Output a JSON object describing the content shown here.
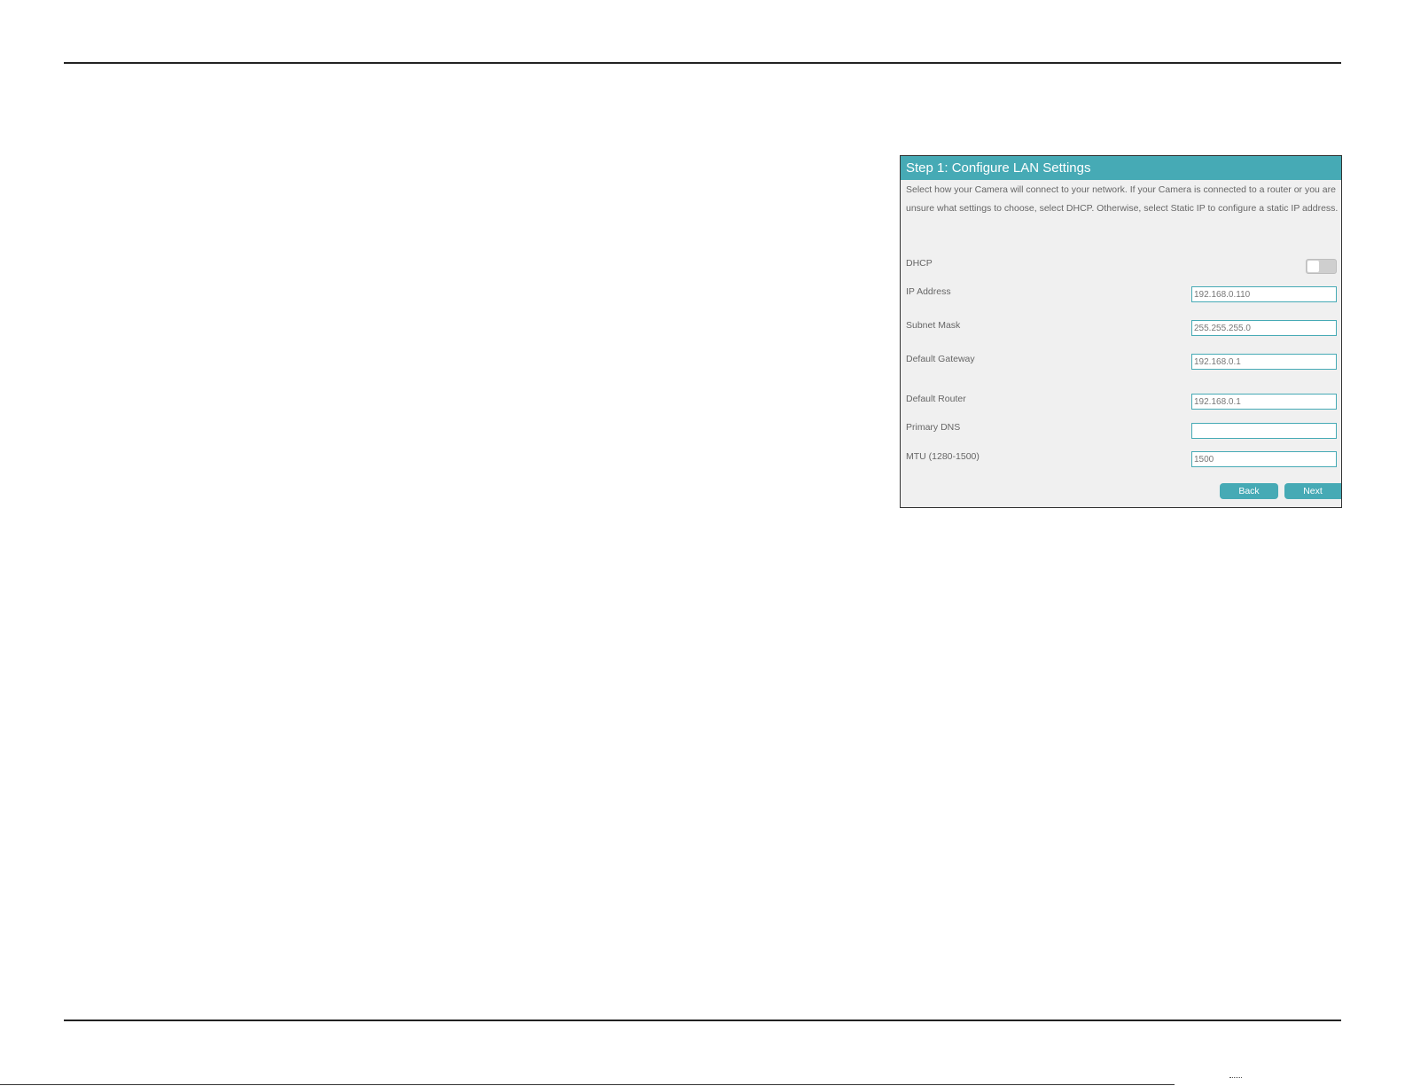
{
  "panel": {
    "title": "Step 1: Configure LAN Settings",
    "description": "Select how your Camera will connect to your network. If your Camera is connected to a router or you are unsure what settings to choose, select DHCP. Otherwise, select Static IP to configure a static IP address."
  },
  "dhcp": {
    "label": "DHCP",
    "enabled": false
  },
  "fields": {
    "ip_address": {
      "label": "IP Address",
      "value": "192.168.0.110"
    },
    "subnet_mask": {
      "label": "Subnet Mask",
      "value": "255.255.255.0"
    },
    "default_gateway": {
      "label": "Default Gateway",
      "value": "192.168.0.1"
    },
    "default_router": {
      "label": "Default Router",
      "value": "192.168.0.1"
    },
    "primary_dns": {
      "label": "Primary DNS",
      "value": ""
    },
    "mtu": {
      "label": "MTU (1280-1500)",
      "value": "1500"
    }
  },
  "buttons": {
    "back": "Back",
    "next": "Next"
  },
  "colors": {
    "accent": "#46aab5",
    "panel_bg": "#f0f0f0",
    "toggle_off": "#cfcfcf"
  }
}
